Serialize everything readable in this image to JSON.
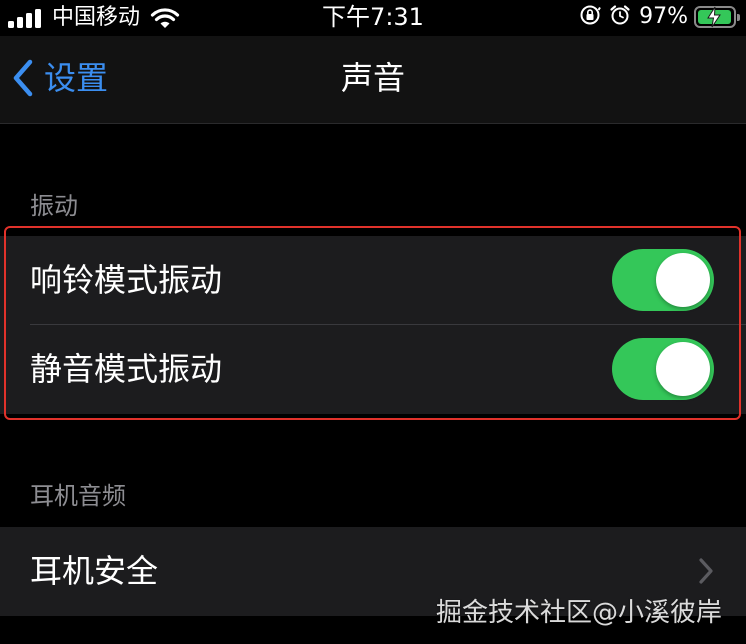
{
  "status_bar": {
    "carrier": "中国移动",
    "time": "下午7:31",
    "battery_percent": "97%",
    "battery_level": 0.97,
    "icons": [
      "signal-icon",
      "wifi-icon",
      "orientation-lock-icon",
      "alarm-icon",
      "battery-charging-icon"
    ]
  },
  "nav": {
    "back_label": "设置",
    "title": "声音"
  },
  "sections": {
    "vibration": {
      "header": "振动",
      "rows": [
        {
          "label": "响铃模式振动",
          "on": true
        },
        {
          "label": "静音模式振动",
          "on": true
        }
      ]
    },
    "headphone_audio": {
      "header": "耳机音频",
      "rows": [
        {
          "label": "耳机安全",
          "chevron": true
        }
      ]
    }
  },
  "watermark": "掘金技术社区@小溪彼岸",
  "colors": {
    "accent": "#3b8ef0",
    "toggle_on": "#34c759",
    "highlight": "#e1322b",
    "background": "#000000",
    "cell": "#1c1c1e"
  }
}
